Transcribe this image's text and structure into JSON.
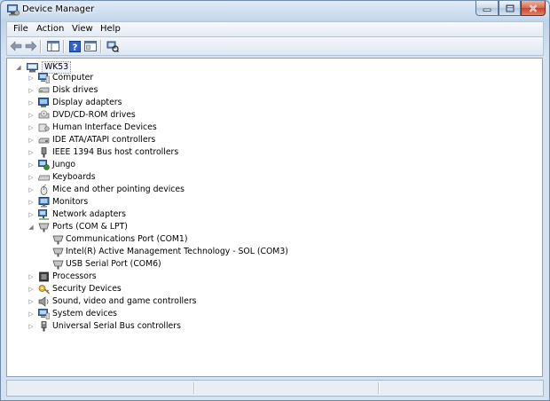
{
  "window": {
    "title": "Device Manager"
  },
  "menu": [
    "File",
    "Action",
    "View",
    "Help"
  ],
  "toolbar": [
    "back-icon",
    "forward-icon",
    "show-hide-console-tree-icon",
    "help-icon",
    "properties-icon",
    "scan-hardware-icon"
  ],
  "tree": {
    "root": "WK53",
    "items": [
      {
        "label": "Computer",
        "icon": "computer-icon"
      },
      {
        "label": "Disk drives",
        "icon": "disk-drive-icon"
      },
      {
        "label": "Display adapters",
        "icon": "display-adapter-icon"
      },
      {
        "label": "DVD/CD-ROM drives",
        "icon": "dvd-drive-icon"
      },
      {
        "label": "Human Interface Devices",
        "icon": "hid-icon"
      },
      {
        "label": "IDE ATA/ATAPI controllers",
        "icon": "ide-controller-icon"
      },
      {
        "label": "IEEE 1394 Bus host controllers",
        "icon": "ieee1394-icon"
      },
      {
        "label": "Jungo",
        "icon": "jungo-icon"
      },
      {
        "label": "Keyboards",
        "icon": "keyboard-icon"
      },
      {
        "label": "Mice and other pointing devices",
        "icon": "mouse-icon"
      },
      {
        "label": "Monitors",
        "icon": "monitor-icon"
      },
      {
        "label": "Network adapters",
        "icon": "network-adapter-icon"
      },
      {
        "label": "Ports (COM & LPT)",
        "icon": "port-icon",
        "expanded": true,
        "children": [
          "Communications Port (COM1)",
          "Intel(R) Active Management Technology - SOL (COM3)",
          "USB Serial Port (COM6)"
        ]
      },
      {
        "label": "Processors",
        "icon": "processor-icon"
      },
      {
        "label": "Security Devices",
        "icon": "security-icon"
      },
      {
        "label": "Sound, video and game controllers",
        "icon": "sound-icon"
      },
      {
        "label": "System devices",
        "icon": "system-devices-icon"
      },
      {
        "label": "Universal Serial Bus controllers",
        "icon": "usb-icon"
      }
    ]
  }
}
